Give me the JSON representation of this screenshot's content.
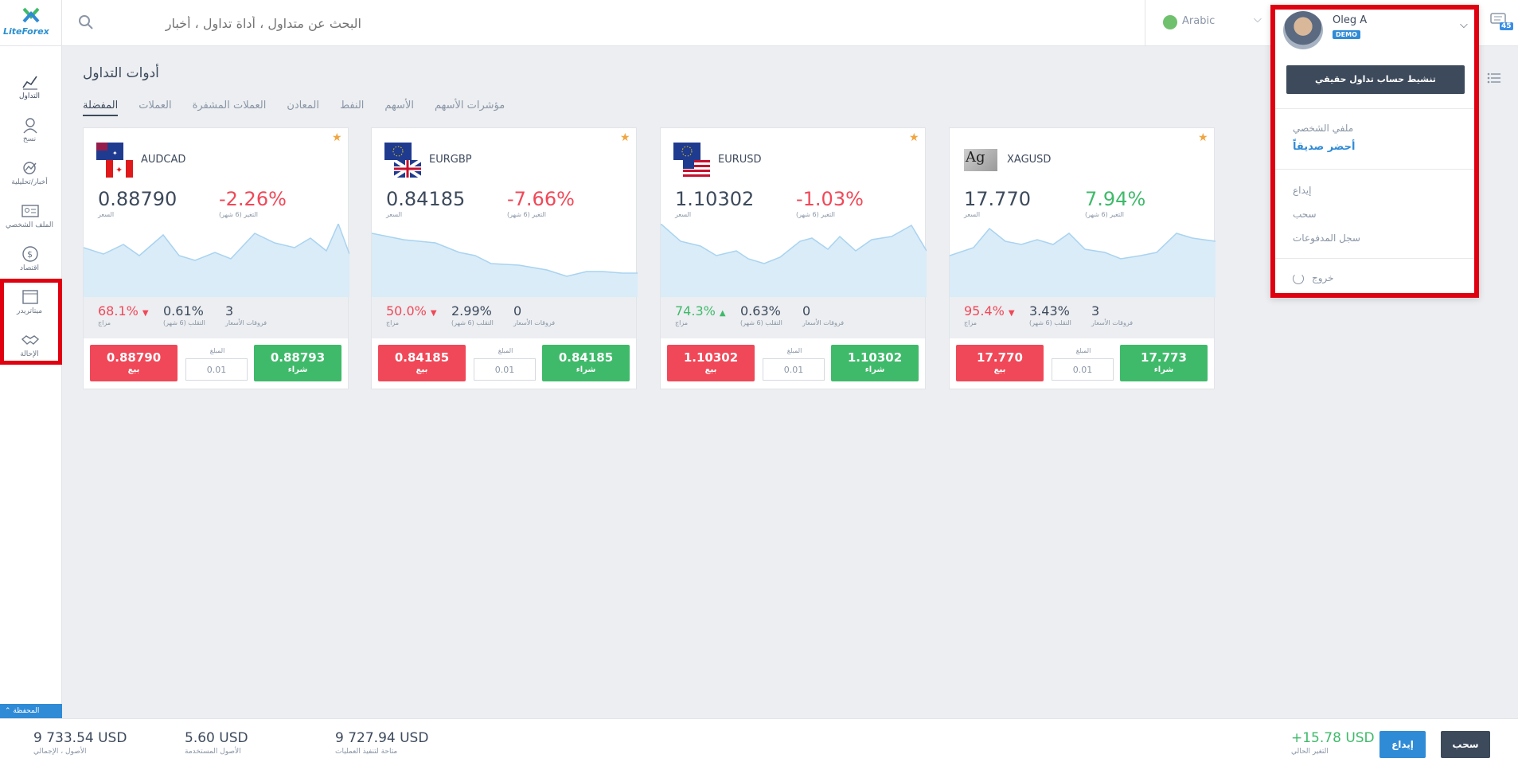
{
  "brand": {
    "name": "LiteForex"
  },
  "search": {
    "placeholder": "البحث عن متداول ، أداة تداول ، أخبار"
  },
  "language": {
    "label": "Arabic"
  },
  "messages": {
    "count": "45"
  },
  "sidebar": {
    "items": [
      {
        "label": "التداول"
      },
      {
        "label": "نسخ"
      },
      {
        "label": "أخبار/تحليلية"
      },
      {
        "label": "الملف الشخصي"
      },
      {
        "label": "اقتصاد"
      },
      {
        "label": "ميتاتريدر"
      },
      {
        "label": "الإحالة"
      }
    ],
    "portfolio_tab": "المحفظة"
  },
  "main": {
    "title": "أدوات التداول",
    "tabs": [
      "المفضلة",
      "العملات",
      "العملات المشفرة",
      "المعادن",
      "النفط",
      "الأسهم",
      "مؤشرات الأسهم"
    ]
  },
  "labels": {
    "price": "السعر",
    "change": "التغير (6 شهر)",
    "sentiment": "مزاج",
    "volatility": "التقلب (6 شهر)",
    "spread": "فروقات الأسعار",
    "amount": "المبلغ",
    "sell": "بيع",
    "buy": "شراء"
  },
  "cards": [
    {
      "symbol": "AUDCAD",
      "price": "0.88790",
      "change": "-2.26%",
      "sentiment": "68.1%",
      "volatility": "0.61%",
      "spread": "3",
      "amount": "0.01",
      "sell": "0.88790",
      "buy": "0.88793",
      "change_color": "#f04858",
      "sentiment_color": "#f04858",
      "sentiment_dir": "▼"
    },
    {
      "symbol": "EURGBP",
      "price": "0.84185",
      "change": "-7.66%",
      "sentiment": "50.0%",
      "volatility": "2.99%",
      "spread": "0",
      "amount": "0.01",
      "sell": "0.84185",
      "buy": "0.84185",
      "change_color": "#f04858",
      "sentiment_color": "#f04858",
      "sentiment_dir": "▼"
    },
    {
      "symbol": "EURUSD",
      "price": "1.10302",
      "change": "-1.03%",
      "sentiment": "74.3%",
      "volatility": "0.63%",
      "spread": "0",
      "amount": "0.01",
      "sell": "1.10302",
      "buy": "1.10302",
      "change_color": "#f04858",
      "sentiment_color": "#3fba6a",
      "sentiment_dir": "▲"
    },
    {
      "symbol": "XAGUSD",
      "price": "17.770",
      "change": "7.94%",
      "sentiment": "95.4%",
      "volatility": "3.43%",
      "spread": "3",
      "amount": "0.01",
      "sell": "17.770",
      "buy": "17.773",
      "change_color": "#3fba6a",
      "sentiment_color": "#f04858",
      "sentiment_dir": "▼"
    }
  ],
  "footer": {
    "total_assets": {
      "value": "9 733.54 USD",
      "label": "الأصول ، الإجمالي"
    },
    "used_assets": {
      "value": "5.60 USD",
      "label": "الأصول المستخدمة"
    },
    "available": {
      "value": "9 727.94 USD",
      "label": "متاحة لتنفيذ العمليات"
    },
    "current_change": {
      "value": "+15.78 USD",
      "label": "التغير الحالي"
    },
    "deposit": "إيداع",
    "withdraw": "سحب"
  },
  "user_menu": {
    "name": "Oleg A",
    "badge": "DEMO",
    "activate": "تنشيط حساب تداول حقيقي",
    "profile": "ملفي الشخصي",
    "invite": "أحضر صديقاً",
    "deposit": "إيداع",
    "withdraw": "سحب",
    "payments": "سجل المدفوعات",
    "logout": "خروج"
  },
  "colors": {
    "accent": "#2f8bd6",
    "sell": "#f04858",
    "buy": "#3fba6a",
    "dark": "#3d4a5c",
    "highlight": "#e0000f"
  },
  "icons": [
    "search-icon",
    "globe-icon",
    "chevron-down-icon",
    "chat-icon",
    "list-icon",
    "star-icon",
    "power-icon",
    "chart-icon",
    "copy-icon",
    "news-icon",
    "profile-icon",
    "economy-icon",
    "metatrader-icon",
    "handshake-icon"
  ]
}
